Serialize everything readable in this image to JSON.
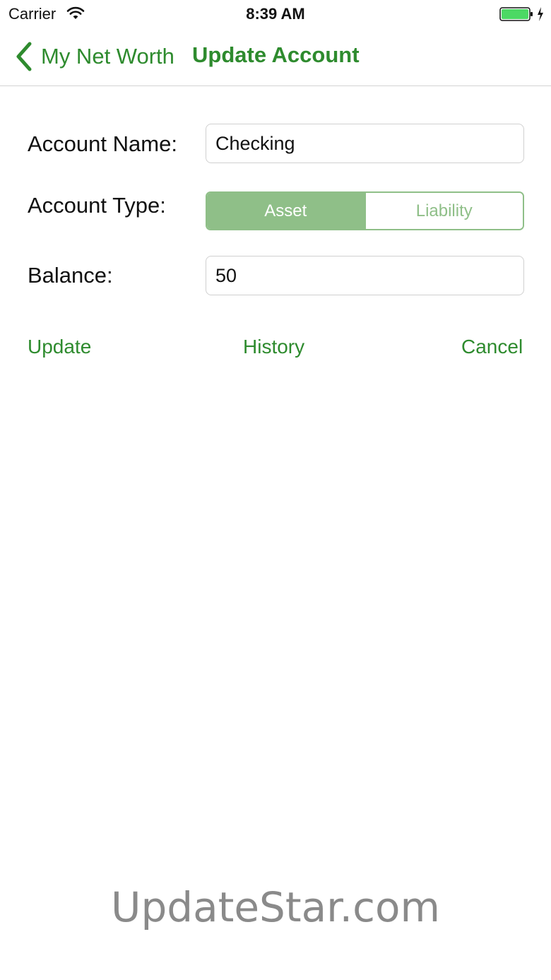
{
  "status_bar": {
    "carrier": "Carrier",
    "time": "8:39 AM",
    "battery_color": "#4cd964"
  },
  "nav": {
    "back_label": "My Net Worth",
    "title": "Update Account",
    "accent_color": "#2e8b2e"
  },
  "form": {
    "account_name_label": "Account Name:",
    "account_name_value": "Checking",
    "account_type_label": "Account Type:",
    "account_type_options": [
      "Asset",
      "Liability"
    ],
    "account_type_selected": "Asset",
    "balance_label": "Balance:",
    "balance_value": "50"
  },
  "actions": {
    "update": "Update",
    "history": "History",
    "cancel": "Cancel"
  },
  "watermark": "UpdateStar.com"
}
